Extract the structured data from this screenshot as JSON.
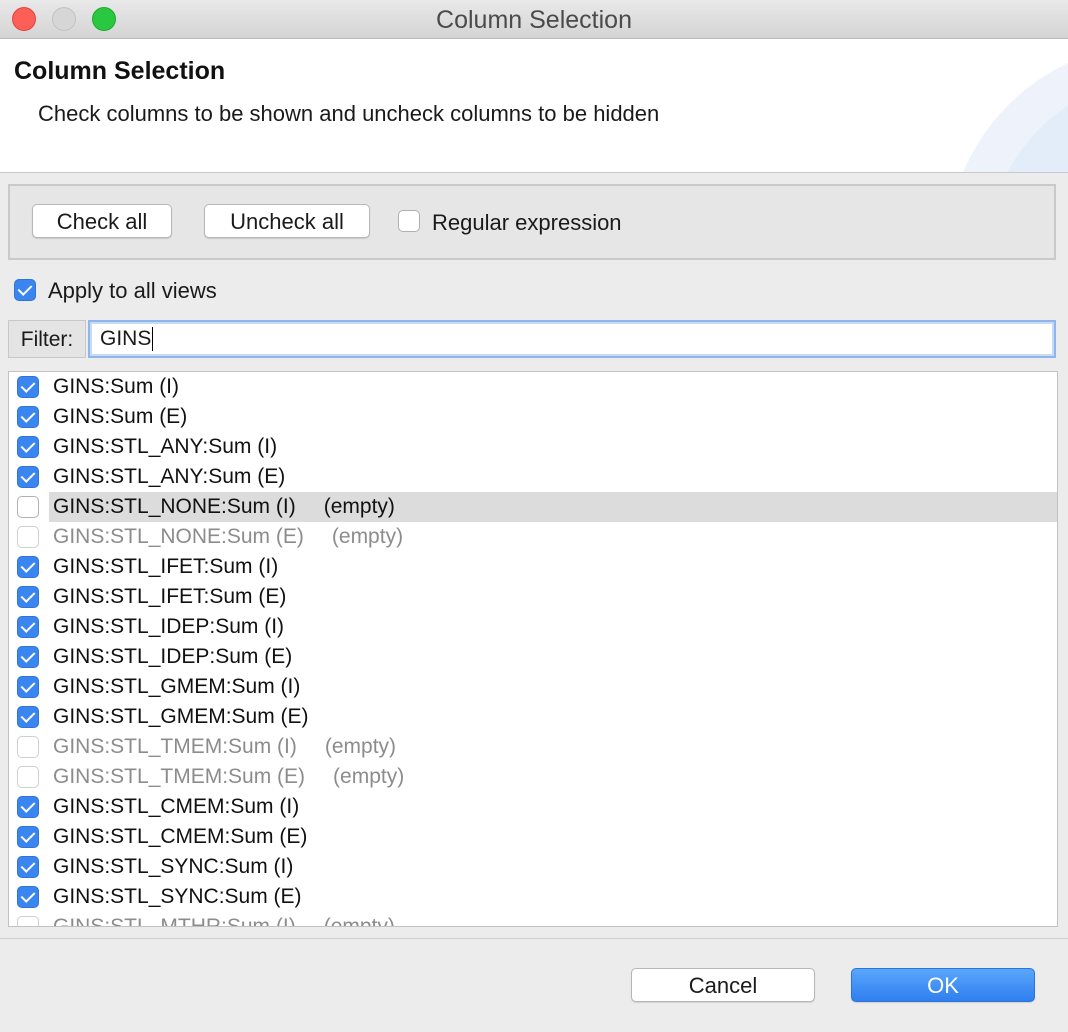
{
  "window": {
    "title": "Column Selection"
  },
  "header": {
    "title": "Column Selection",
    "description": "Check columns to be shown and uncheck columns to be hidden"
  },
  "toolbar": {
    "check_all_label": "Check all",
    "uncheck_all_label": "Uncheck all",
    "regex_label": "Regular expression",
    "regex_checked": false
  },
  "apply": {
    "label": "Apply to all views",
    "checked": true
  },
  "filter": {
    "label": "Filter:",
    "value": "GINS"
  },
  "columns": [
    {
      "name": "GINS:Sum (I)",
      "checked": true,
      "empty": "",
      "disabled": false,
      "selected": false
    },
    {
      "name": "GINS:Sum (E)",
      "checked": true,
      "empty": "",
      "disabled": false,
      "selected": false
    },
    {
      "name": "GINS:STL_ANY:Sum (I)",
      "checked": true,
      "empty": "",
      "disabled": false,
      "selected": false
    },
    {
      "name": "GINS:STL_ANY:Sum (E)",
      "checked": true,
      "empty": "",
      "disabled": false,
      "selected": false
    },
    {
      "name": "GINS:STL_NONE:Sum (I)",
      "checked": false,
      "empty": "(empty)",
      "disabled": false,
      "selected": true
    },
    {
      "name": "GINS:STL_NONE:Sum (E)",
      "checked": false,
      "empty": "(empty)",
      "disabled": true,
      "selected": false
    },
    {
      "name": "GINS:STL_IFET:Sum (I)",
      "checked": true,
      "empty": "",
      "disabled": false,
      "selected": false
    },
    {
      "name": "GINS:STL_IFET:Sum (E)",
      "checked": true,
      "empty": "",
      "disabled": false,
      "selected": false
    },
    {
      "name": "GINS:STL_IDEP:Sum (I)",
      "checked": true,
      "empty": "",
      "disabled": false,
      "selected": false
    },
    {
      "name": "GINS:STL_IDEP:Sum (E)",
      "checked": true,
      "empty": "",
      "disabled": false,
      "selected": false
    },
    {
      "name": "GINS:STL_GMEM:Sum (I)",
      "checked": true,
      "empty": "",
      "disabled": false,
      "selected": false
    },
    {
      "name": "GINS:STL_GMEM:Sum (E)",
      "checked": true,
      "empty": "",
      "disabled": false,
      "selected": false
    },
    {
      "name": "GINS:STL_TMEM:Sum (I)",
      "checked": false,
      "empty": "(empty)",
      "disabled": true,
      "selected": false
    },
    {
      "name": "GINS:STL_TMEM:Sum (E)",
      "checked": false,
      "empty": "(empty)",
      "disabled": true,
      "selected": false
    },
    {
      "name": "GINS:STL_CMEM:Sum (I)",
      "checked": true,
      "empty": "",
      "disabled": false,
      "selected": false
    },
    {
      "name": "GINS:STL_CMEM:Sum (E)",
      "checked": true,
      "empty": "",
      "disabled": false,
      "selected": false
    },
    {
      "name": "GINS:STL_SYNC:Sum (I)",
      "checked": true,
      "empty": "",
      "disabled": false,
      "selected": false
    },
    {
      "name": "GINS:STL_SYNC:Sum (E)",
      "checked": true,
      "empty": "",
      "disabled": false,
      "selected": false
    },
    {
      "name": "GINS:STL_MTHR:Sum (I)",
      "checked": false,
      "empty": "(empty)",
      "disabled": true,
      "selected": false
    }
  ],
  "footer": {
    "cancel_label": "Cancel",
    "ok_label": "OK"
  },
  "colors": {
    "accent": "#3a85f0",
    "selection": "#dcdcdc",
    "disabled_text": "#8c8c8c"
  }
}
